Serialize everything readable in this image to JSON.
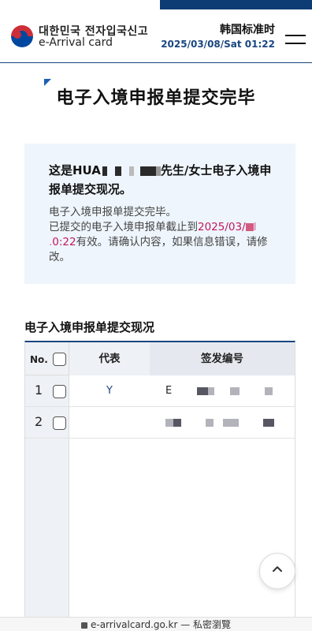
{
  "header": {
    "brand_ko": "대한민국 전자입국신고",
    "brand_en": "e-Arrival card",
    "tz_label": "韩国标准时",
    "tz_time": "2025/03/08/Sat 01:22",
    "logo_icon": "taegeuk-logo-icon",
    "menu_icon": "hamburger-menu-icon"
  },
  "page": {
    "title": "电子入境申报单提交完毕"
  },
  "notice": {
    "head_prefix": "这是HUA",
    "head_suffix": "先生/女士电子入境申报单提交现况。",
    "line1": "电子入境申报单提交完毕。",
    "line2_prefix": "已提交的电子入境申报单截止到",
    "deadline_a": "2025/03/",
    "deadline_b": "0:22",
    "line2_suffix": "有效。请确认内容，如果信息错误，请修改。"
  },
  "section": {
    "title": "电子入境申报单提交现况"
  },
  "table": {
    "headers": {
      "no": "No.",
      "representative": "代表",
      "issue_number": "签发编号"
    },
    "rows": [
      {
        "no": "1",
        "representative": "Y",
        "issue_number": "E"
      },
      {
        "no": "2",
        "representative": "",
        "issue_number": ""
      }
    ]
  },
  "scroll_top_icon": "chevron-up-icon",
  "browser": {
    "url": "e-arrivalcard.go.kr — 私密瀏覽"
  },
  "colors": {
    "brand_navy": "#1a4680",
    "notice_bg": "#eef5fc",
    "highlight": "#c2185b"
  }
}
